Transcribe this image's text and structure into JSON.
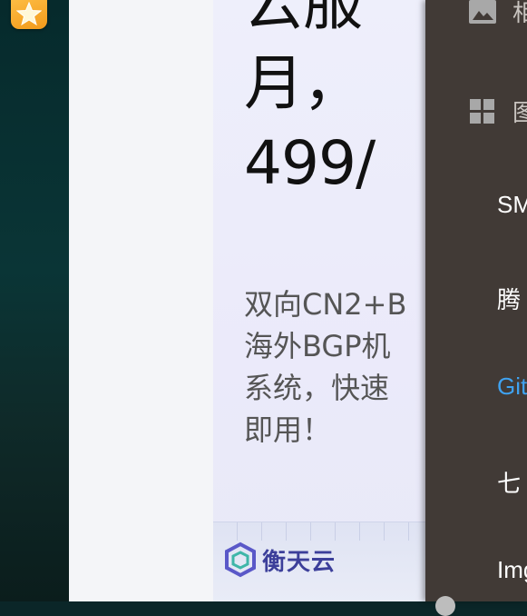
{
  "desktop": {
    "app_icon": "star-app-icon"
  },
  "ad": {
    "title": "云服\n月，\n499/",
    "description": "双向CN2+B\n海外BGP机\n系统，快速\n即用！",
    "brand": "衡天云"
  },
  "drawer": {
    "items": [
      {
        "label": "相",
        "icon": "image-icon"
      },
      {
        "label": "图",
        "icon": "grid-icon"
      },
      {
        "label": "SM"
      },
      {
        "label": "腾"
      },
      {
        "label": "Git",
        "active": true
      },
      {
        "label": "七"
      },
      {
        "label": "Img"
      }
    ],
    "accent_color": "#3fa2f0"
  }
}
